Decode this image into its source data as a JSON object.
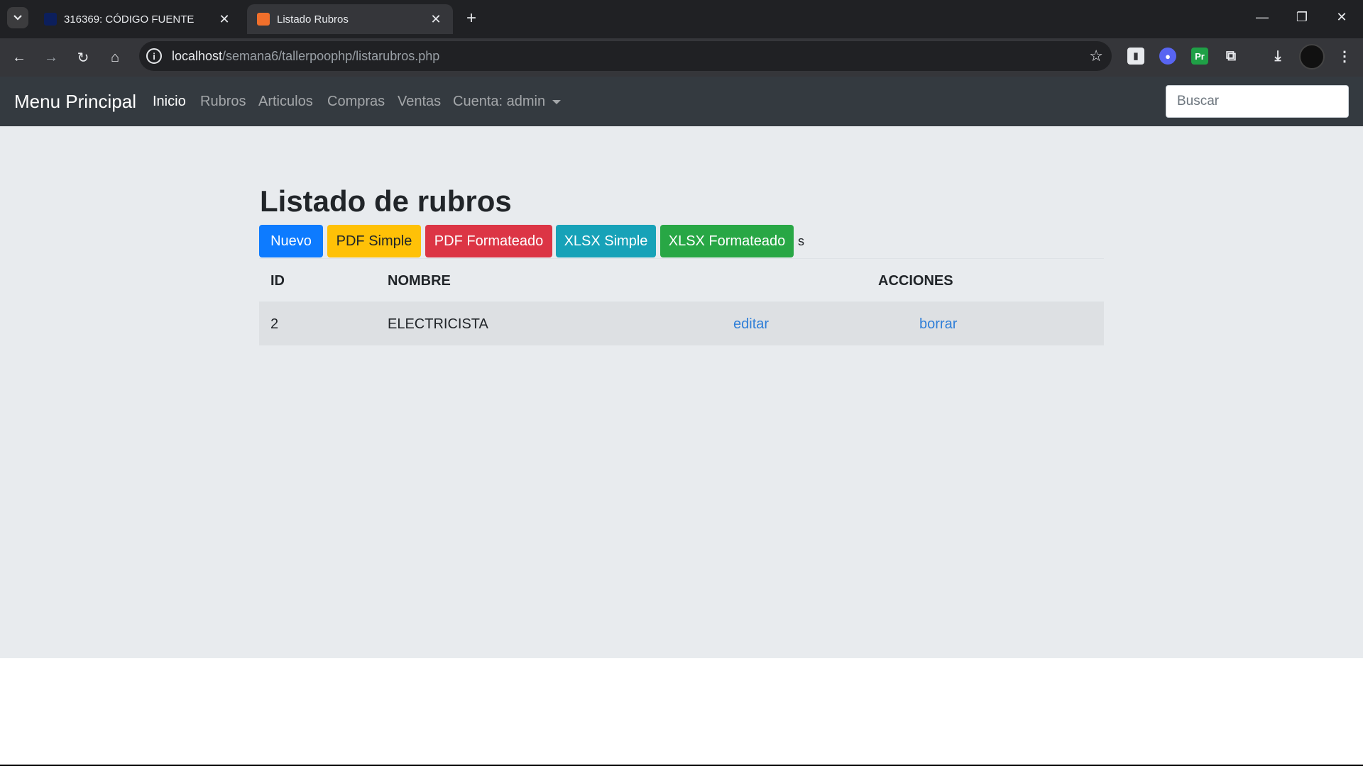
{
  "browser": {
    "tabs": [
      {
        "title": "316369: CÓDIGO FUENTE",
        "active": false
      },
      {
        "title": "Listado Rubros",
        "active": true
      }
    ],
    "url_host": "localhost",
    "url_path": "/semana6/tallerpoophp/listarubros.php",
    "extension_badge": "Pr"
  },
  "navbar": {
    "brand": "Menu Principal",
    "links": [
      "Inicio",
      "Rubros",
      "Articulos",
      "Compras",
      "Ventas",
      "Cuenta: admin"
    ],
    "active_link": "Inicio",
    "search_placeholder": "Buscar"
  },
  "main": {
    "title": "Listado de rubros",
    "buttons": [
      {
        "label": "Nuevo",
        "color": "#0d7bff"
      },
      {
        "label": "PDF Simple",
        "color": "#ffc107"
      },
      {
        "label": "PDF Formateado",
        "color": "#dc3545"
      },
      {
        "label": "XLSX Simple",
        "color": "#17a2b8"
      },
      {
        "label": "XLSX Formateado",
        "color": "#28a745"
      }
    ],
    "stray_text": "s",
    "table": {
      "headers": {
        "id": "ID",
        "nombre": "NOMBRE",
        "acciones": "ACCIONES"
      },
      "rows": [
        {
          "id": "2",
          "nombre": "ELECTRICISTA",
          "edit": "editar",
          "delete": "borrar"
        }
      ]
    }
  },
  "colors": {
    "navbar_bg": "#343a40",
    "page_bg": "#e8ebee",
    "link": "#2f7fd8"
  }
}
